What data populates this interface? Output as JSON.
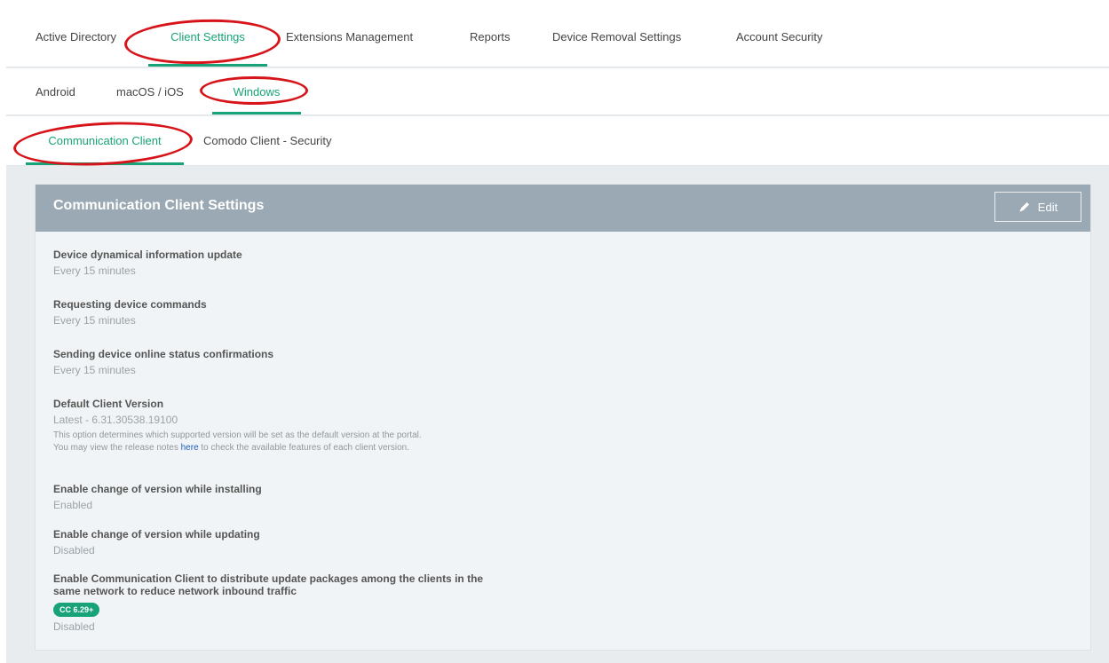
{
  "top_tabs": [
    "Active Directory",
    "Client Settings",
    "Extensions Management",
    "Reports",
    "Device Removal Settings",
    "Account Security"
  ],
  "top_tab_active": "Client Settings",
  "os_tabs": [
    "Android",
    "macOS / iOS",
    "Windows"
  ],
  "os_tab_active": "Windows",
  "sub_tabs": [
    "Communication Client",
    "Comodo Client - Security"
  ],
  "sub_tab_active": "Communication Client",
  "panel": {
    "title": "Communication Client Settings",
    "edit_label": "Edit",
    "settings": [
      {
        "label": "Device dynamical information update",
        "value": "Every 15 minutes"
      },
      {
        "label": "Requesting device commands",
        "value": "Every 15 minutes"
      },
      {
        "label": "Sending device online status confirmations",
        "value": "Every 15 minutes"
      },
      {
        "label": "Default Client Version",
        "value": "Latest - 6.31.30538.19100",
        "note1": "This option determines which supported version will be set as the default version at the portal.",
        "note2_pre": "You may view the release notes ",
        "note2_link": "here",
        "note2_post": " to check the available features of each client version."
      },
      {
        "label": "Enable change of version while installing",
        "value": "Enabled"
      },
      {
        "label": "Enable change of version while updating",
        "value": "Disabled"
      },
      {
        "label": "Enable Communication Client to distribute update packages among the clients in the",
        "label2": "same network to reduce network inbound traffic",
        "badge": "CC 6.29+",
        "value": "Disabled"
      }
    ]
  },
  "colors": {
    "accent": "#17a377",
    "highlight": "#d7141a",
    "header": "#9aa9b3"
  }
}
